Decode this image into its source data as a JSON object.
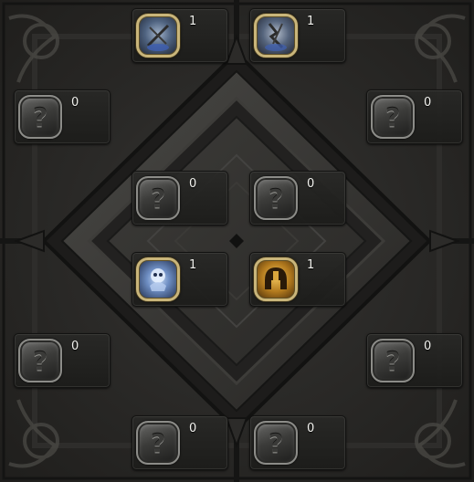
{
  "slots": {
    "top_left": {
      "icon": "crossed-swords-blue-icon",
      "count": "1"
    },
    "top_right": {
      "icon": "lightning-sword-blue-icon",
      "count": "1"
    },
    "upper_left": {
      "icon": "question-mark-icon",
      "count": "0"
    },
    "upper_right": {
      "icon": "question-mark-icon",
      "count": "0"
    },
    "inner_tl": {
      "icon": "question-mark-icon",
      "count": "0"
    },
    "inner_tr": {
      "icon": "question-mark-icon",
      "count": "0"
    },
    "inner_bl": {
      "icon": "ghost-skull-icon",
      "count": "1"
    },
    "inner_br": {
      "icon": "gold-helmet-icon",
      "count": "1"
    },
    "lower_left": {
      "icon": "question-mark-icon",
      "count": "0"
    },
    "lower_right": {
      "icon": "question-mark-icon",
      "count": "0"
    },
    "bottom_left": {
      "icon": "question-mark-icon",
      "count": "0"
    },
    "bottom_right": {
      "icon": "question-mark-icon",
      "count": "0"
    }
  },
  "question_mark": "?",
  "colors": {
    "frame_gold": "#c9b57a",
    "count_text": "#f2f2ee",
    "stone_dark": "#1c1c1b",
    "stone_mid": "#3a3936"
  }
}
